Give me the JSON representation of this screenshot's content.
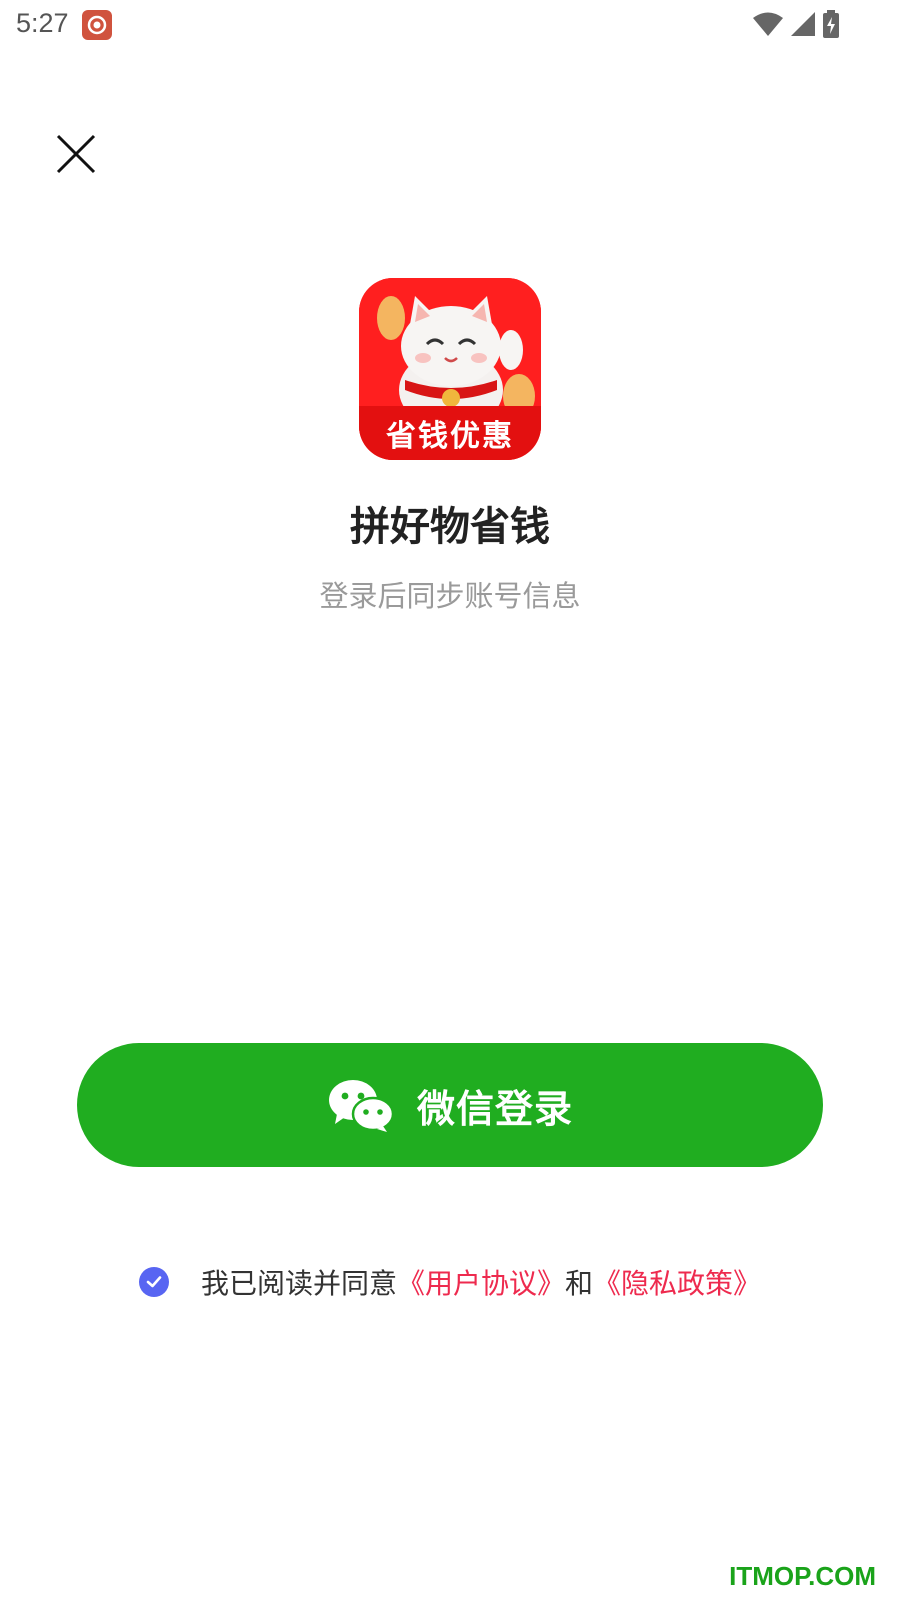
{
  "status_bar": {
    "time": "5:27",
    "icons": [
      "notification-app-icon",
      "wifi-icon",
      "signal-icon",
      "battery-charging-icon"
    ]
  },
  "header": {
    "close_icon": "close-icon"
  },
  "app": {
    "logo_banner_text": "省钱优惠",
    "name": "拼好物省钱",
    "subtitle": "登录后同步账号信息"
  },
  "login": {
    "button_label": "微信登录",
    "button_icon": "wechat-icon",
    "button_color": "#20ad20"
  },
  "agreement": {
    "checked": true,
    "prefix": "我已阅读并同意",
    "user_agreement": "《用户协议》",
    "conjunction": "和",
    "privacy_policy": "《隐私政策》",
    "link_color": "#ee2a4e",
    "check_color": "#5865f2"
  },
  "watermark": "ITMOP.COM"
}
